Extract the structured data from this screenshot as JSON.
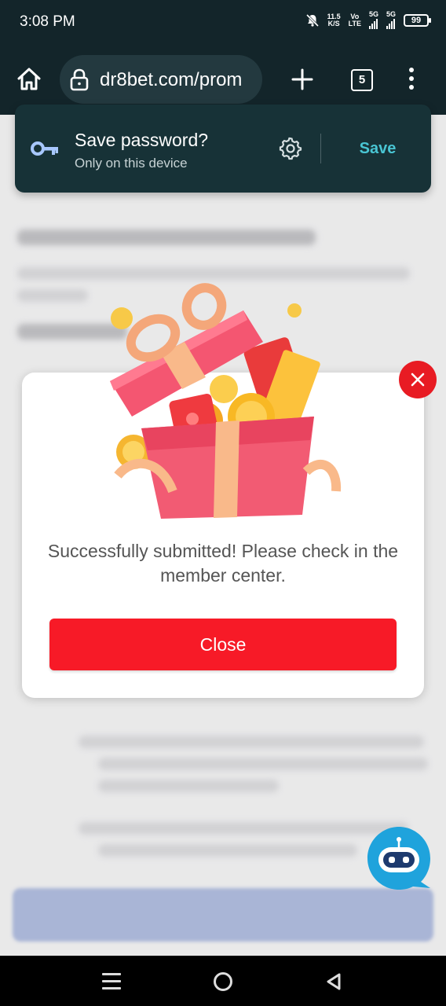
{
  "status_bar": {
    "time": "3:08 PM",
    "net_speed_value": "11.5",
    "net_speed_unit": "K/S",
    "volte_top": "Vo",
    "volte_bottom": "LTE",
    "signal1_label": "5G",
    "signal2_label": "5G",
    "battery": "99"
  },
  "browser": {
    "url": "dr8bet.com/prom",
    "tab_count": "5"
  },
  "save_password": {
    "title": "Save password?",
    "subtitle": "Only on this device",
    "save_label": "Save"
  },
  "dialog": {
    "message": "Successfully submitted! Please check in the member center.",
    "close_label": "Close"
  },
  "colors": {
    "status_bar_bg": "#13252a",
    "save_accent": "#49c5d3",
    "close_button": "#f71a27",
    "chatbot": "#1fa3dc"
  }
}
